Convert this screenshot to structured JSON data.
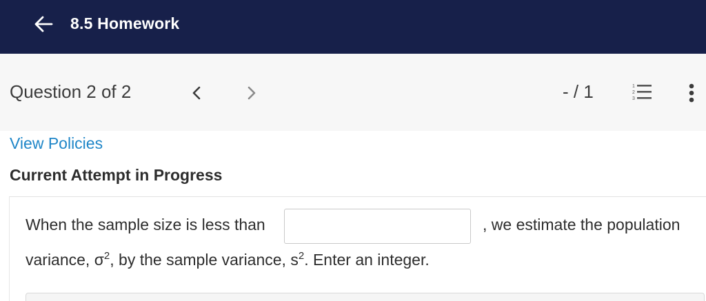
{
  "header": {
    "title": "8.5 Homework",
    "back_icon": "arrow-left-icon",
    "background_color": "#17204a"
  },
  "question_bar": {
    "label": "Question 2 of 2",
    "prev_icon": "chevron-left-icon",
    "next_icon": "chevron-right-icon",
    "score": "- / 1",
    "list_icon": "numbered-list-icon",
    "more_icon": "vertical-dots-icon"
  },
  "links": {
    "view_policies": "View Policies"
  },
  "attempt_heading": "Current Attempt in Progress",
  "question": {
    "text_before": "When the sample size is less than",
    "answer_value": "",
    "text_after": ", we estimate the population",
    "line2_part1": "variance, σ",
    "line2_sup1": "2",
    "line2_part2": ", by the sample variance, s",
    "line2_sup2": "2",
    "line2_part3": ". Enter an integer."
  },
  "colors": {
    "link": "#1f86c8",
    "header_bg": "#17204a",
    "question_bar_bg": "#f7f7f7"
  }
}
